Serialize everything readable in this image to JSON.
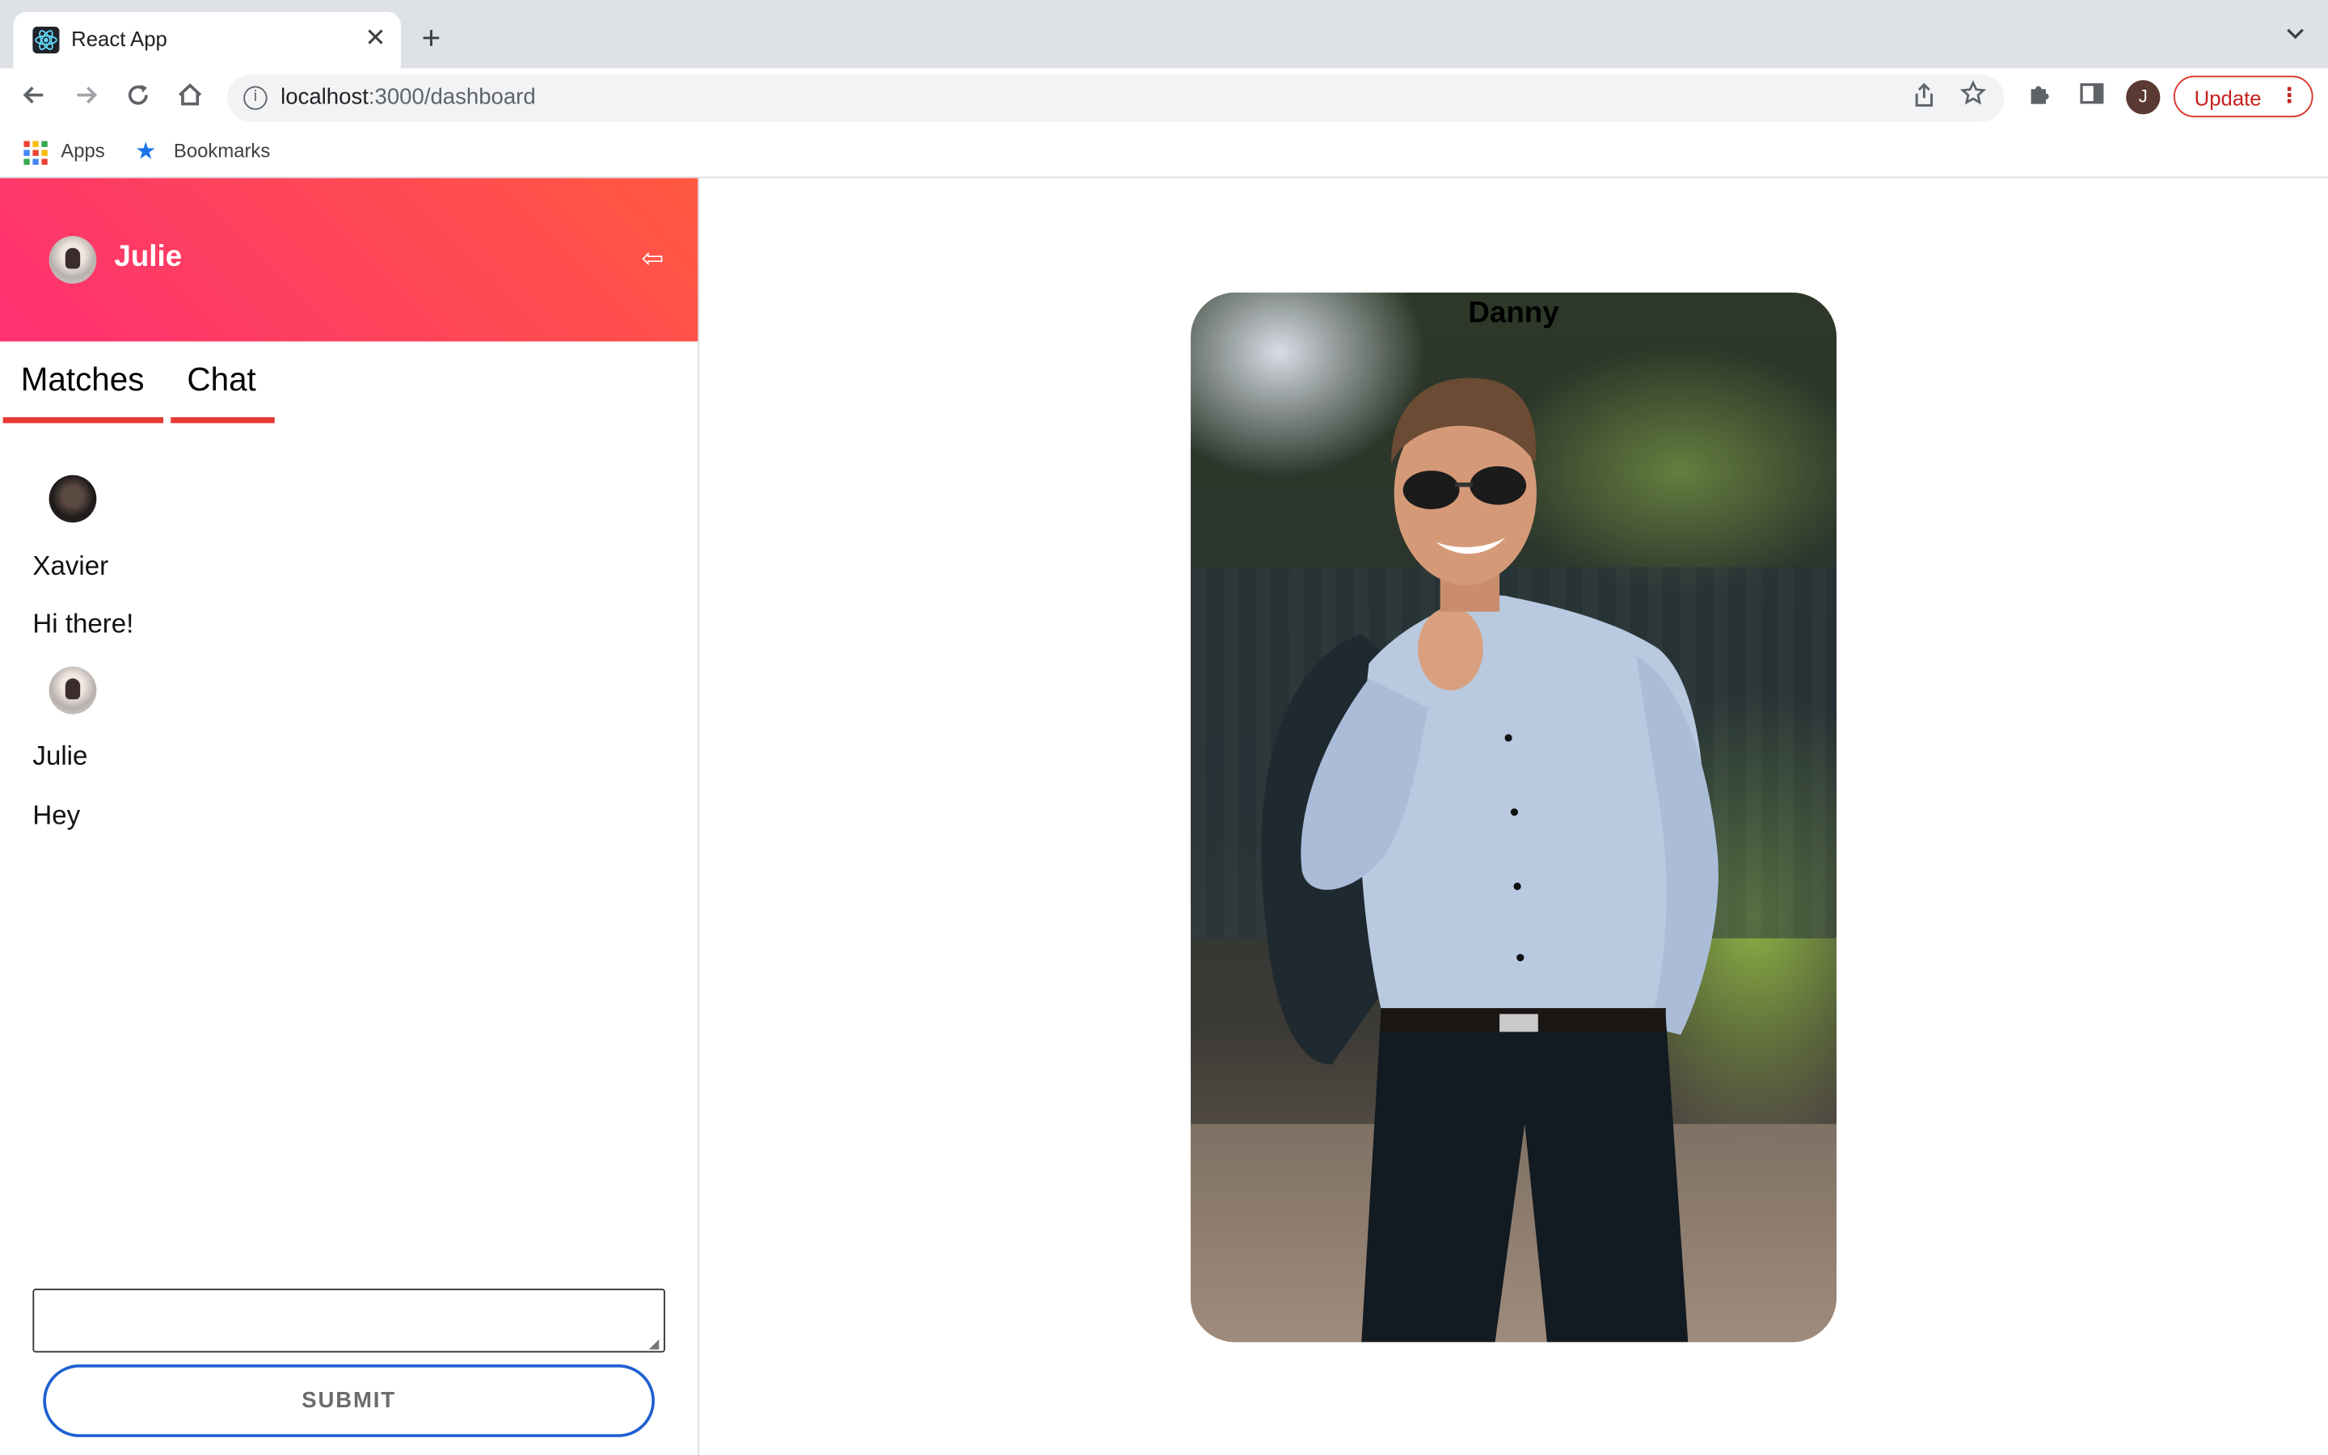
{
  "browser": {
    "tab_title": "React App",
    "tab_close": "✕",
    "new_tab": "+",
    "tab_list": "⌄",
    "url_host": "localhost",
    "url_path": ":3000/dashboard",
    "update_label": "Update",
    "profile_initial": "J",
    "bookmarks": {
      "apps_label": "Apps",
      "bookmarks_label": "Bookmarks"
    },
    "icons": [
      "back-icon",
      "forward-icon",
      "reload-icon",
      "home-icon",
      "info-icon",
      "share-icon",
      "star-icon",
      "extensions-icon",
      "side-panel-icon",
      "menu-icon"
    ]
  },
  "sidebar": {
    "header": {
      "user_name": "Julie",
      "gradient": [
        "#fe3072",
        "#ff5940"
      ]
    },
    "tabs": [
      {
        "label": "Matches"
      },
      {
        "label": "Chat"
      }
    ],
    "tab_accent": "#e53935",
    "messages": [
      {
        "name": "Xavier",
        "text": "Hi there!"
      },
      {
        "name": "Julie",
        "text": "Hey"
      }
    ],
    "input": {
      "value": "",
      "placeholder": ""
    },
    "submit_label": "SUBMIT",
    "submit_border": "#1f5fd1"
  },
  "card": {
    "name": "Danny"
  }
}
